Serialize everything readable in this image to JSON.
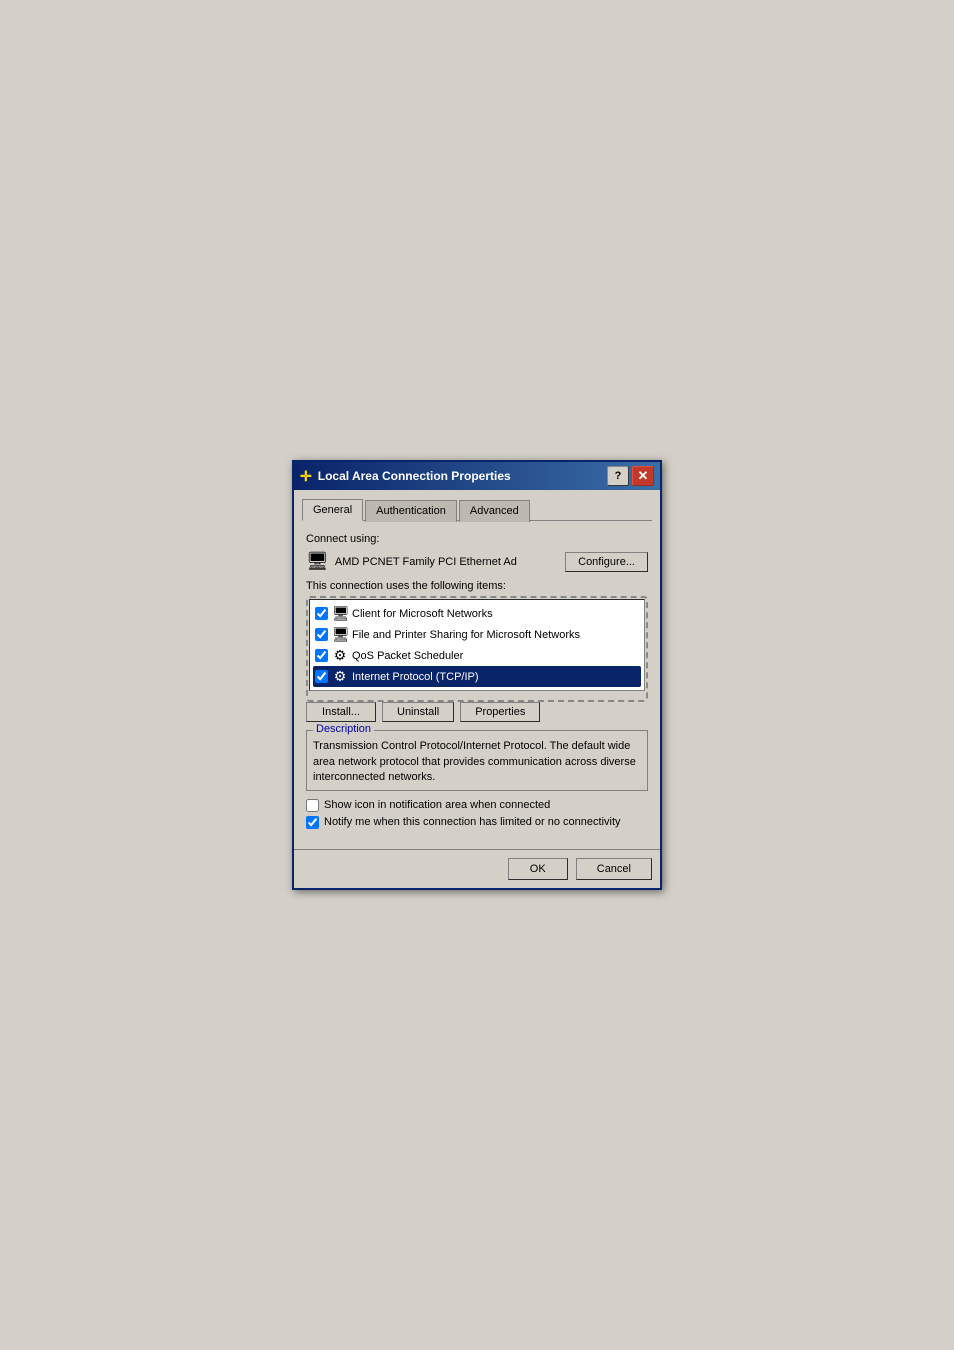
{
  "dialog": {
    "title": "Local Area Connection Properties",
    "title_icon": "✛",
    "tabs": [
      {
        "id": "general",
        "label": "General",
        "active": true
      },
      {
        "id": "authentication",
        "label": "Authentication",
        "active": false
      },
      {
        "id": "advanced",
        "label": "Advanced",
        "active": false
      }
    ],
    "connect_using_label": "Connect using:",
    "adapter_name": "AMD PCNET Family PCI Ethernet Ad",
    "configure_btn": "Configure...",
    "items_label": "This connection uses the following items:",
    "items": [
      {
        "id": "item1",
        "checked": true,
        "label": "Client for Microsoft Networks"
      },
      {
        "id": "item2",
        "checked": true,
        "label": "File and Printer Sharing for Microsoft Networks"
      },
      {
        "id": "item3",
        "checked": true,
        "label": "QoS Packet Scheduler"
      },
      {
        "id": "item4",
        "checked": true,
        "label": "Internet Protocol (TCP/IP)",
        "selected": true
      }
    ],
    "install_btn": "Install...",
    "uninstall_btn": "Uninstall",
    "properties_btn": "Properties",
    "description_legend": "Description",
    "description_text": "Transmission Control Protocol/Internet Protocol. The default wide area network protocol that provides communication across diverse interconnected networks.",
    "show_icon_label": "Show icon in notification area when connected",
    "show_icon_checked": false,
    "notify_label": "Notify me when this connection has limited or no connectivity",
    "notify_checked": true,
    "ok_btn": "OK",
    "cancel_btn": "Cancel"
  }
}
